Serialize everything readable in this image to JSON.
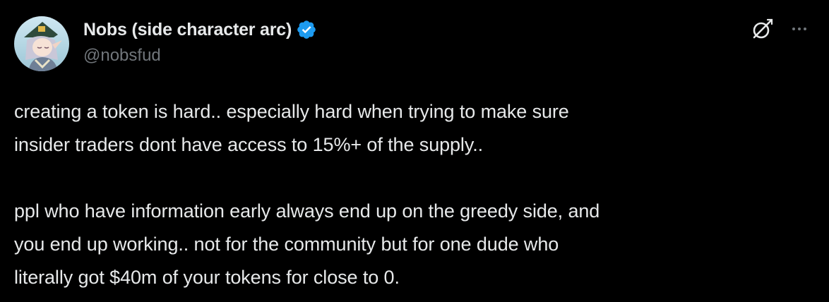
{
  "author": {
    "display_name": "Nobs (side character arc)",
    "handle": "@nobsfud",
    "verified": true,
    "verified_color": "#1d9bf0",
    "avatar_icon": "anime-character-avatar"
  },
  "actions": {
    "grok_icon": "grok-slash-circle-icon",
    "more_icon": "ellipsis-icon"
  },
  "tweet": {
    "paragraphs": [
      {
        "lines": [
          "creating a token is hard.. especially hard when trying to make sure",
          "insider traders dont have access to 15%+ of the supply.."
        ]
      },
      {
        "lines": [
          "ppl who have information early always end up on the greedy side, and",
          "you end up working.. not for the community but for one dude who",
          "literally got $40m of your tokens for close to 0."
        ]
      }
    ]
  },
  "theme": {
    "background": "#000000",
    "text": "#e7e9ea",
    "secondary_text": "#71767b"
  }
}
